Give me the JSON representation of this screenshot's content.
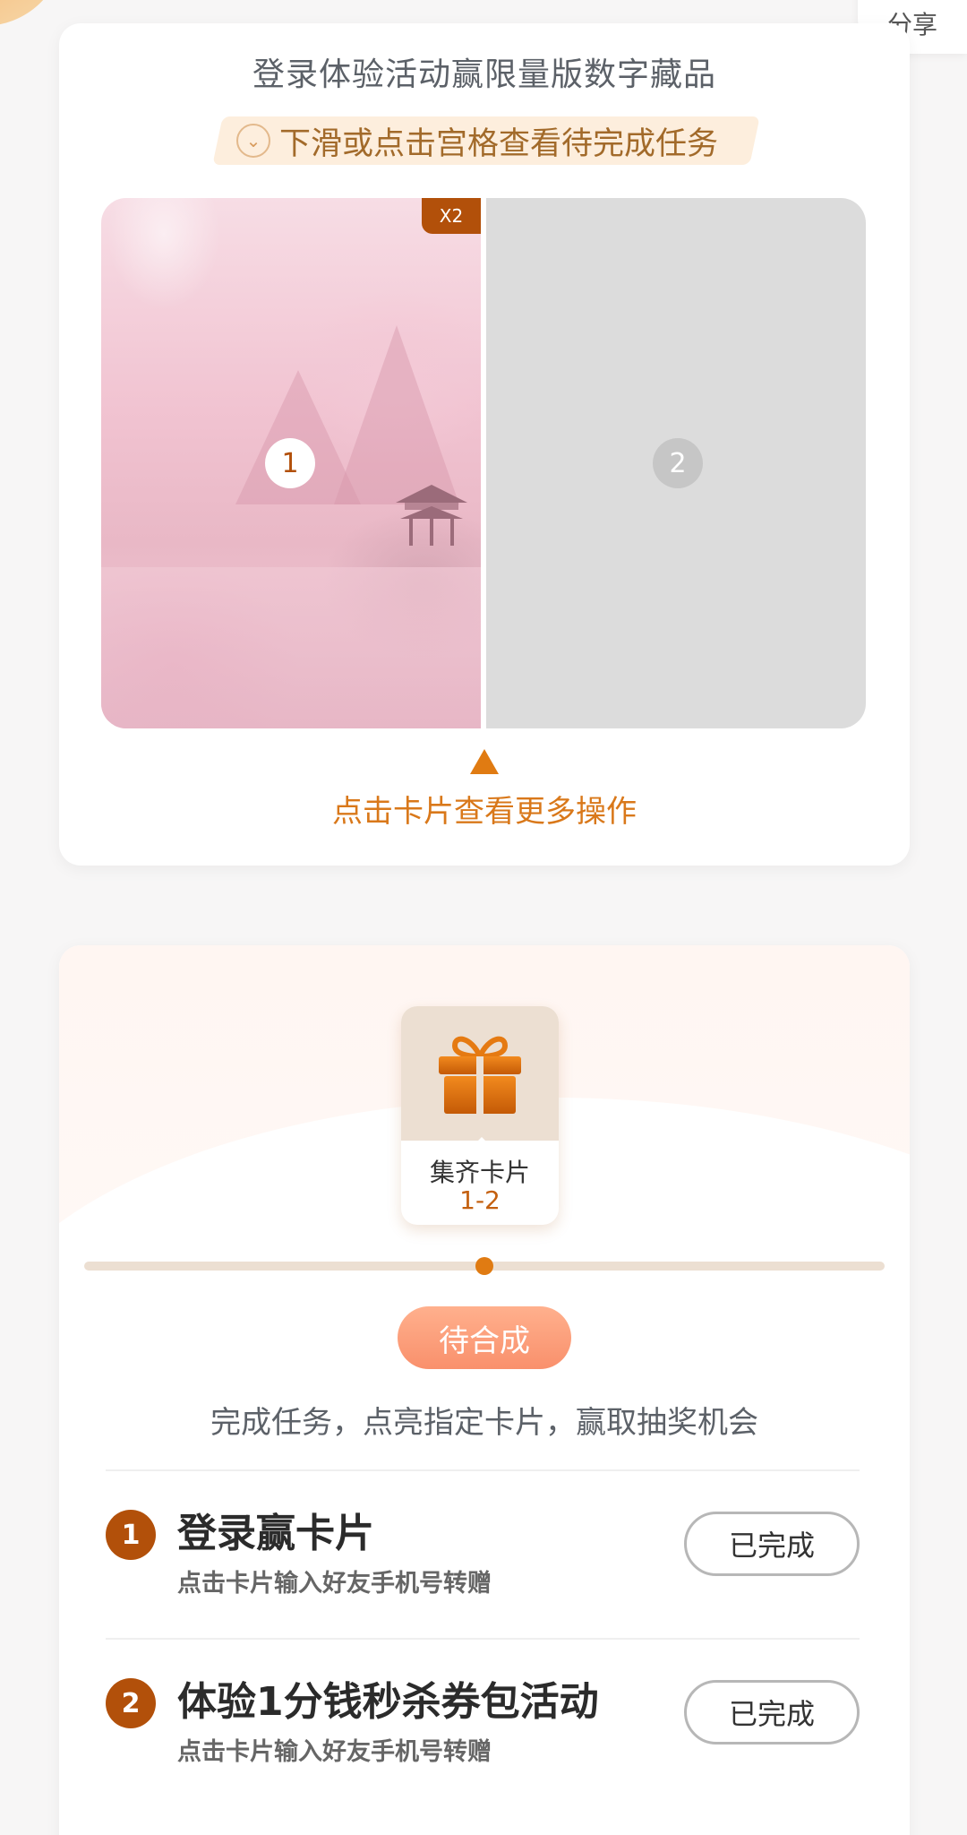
{
  "share_label": "分享",
  "card1": {
    "title": "登录体验活动赢限量版数字藏品",
    "hint": "下滑或点击宫格查看待完成任务",
    "cells": [
      {
        "number": "1",
        "badge": "X2"
      },
      {
        "number": "2"
      }
    ],
    "tap_hint": "点击卡片查看更多操作"
  },
  "card2": {
    "reward_label": "集齐卡片",
    "reward_range": "1-2",
    "progress": 0.5,
    "status_button": "待合成",
    "intro": "完成任务，点亮指定卡片，赢取抽奖机会",
    "tasks": [
      {
        "number": "1",
        "title": "登录赢卡片",
        "subtitle": "点击卡片输入好友手机号转赠",
        "button": "已完成"
      },
      {
        "number": "2",
        "title": "体验1分钱秒杀券包活动",
        "subtitle": "点击卡片输入好友手机号转赠",
        "button": "已完成"
      }
    ]
  },
  "colors": {
    "accent": "#b2500a",
    "orange": "#e07b12",
    "status_pink": "#f9906c",
    "empty_cell": "#dcdcdc"
  }
}
